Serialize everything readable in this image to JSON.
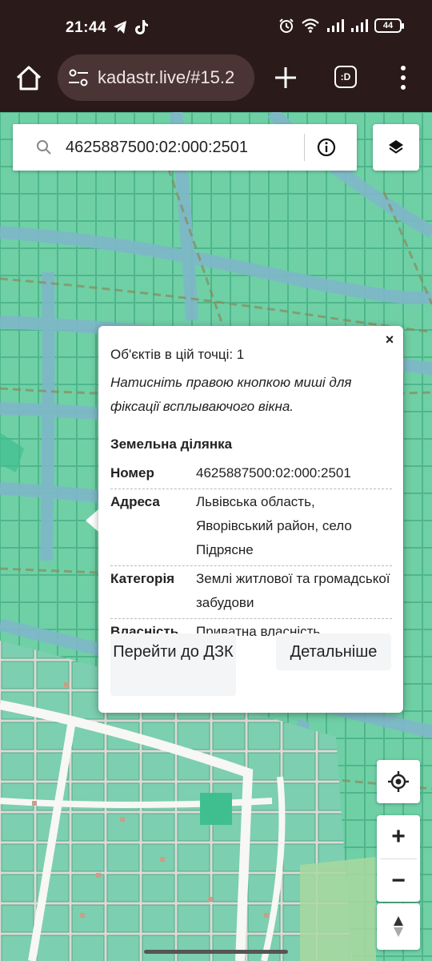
{
  "status": {
    "time": "21:44",
    "battery": "44"
  },
  "browser": {
    "url": "kadastr.live/#15.2",
    "tabs_label": ":D"
  },
  "search": {
    "value": "4625887500:02:000:2501"
  },
  "popup": {
    "close_label": "×",
    "count_text": "Об'єктів в цій точці: 1",
    "hint_text": "Натисніть правою кнопкою миші для фіксації всплываючого вікна.",
    "heading": "Земельна ділянка",
    "rows": [
      {
        "key": "Номер",
        "value": "4625887500:02:000:2501"
      },
      {
        "key": "Адреса",
        "value": "Львівська область, Яворівський район, село Підрясне"
      },
      {
        "key": "Категорія",
        "value": "Землі житлової та громадської забудови"
      },
      {
        "key": "Власність",
        "value": "Приватна власність"
      }
    ],
    "btn_dzk": "Перейти до ДЗК",
    "btn_more": "Детальніше"
  },
  "controls": {
    "zoom_in": "+",
    "zoom_out": "−"
  },
  "colors": {
    "parcel": "#6fd0a6",
    "parcel_stroke": "#3fa882",
    "road_blue": "#7fb7c9",
    "street_light": "#e8e6e2",
    "accent_dark": "#2b1a1a"
  }
}
